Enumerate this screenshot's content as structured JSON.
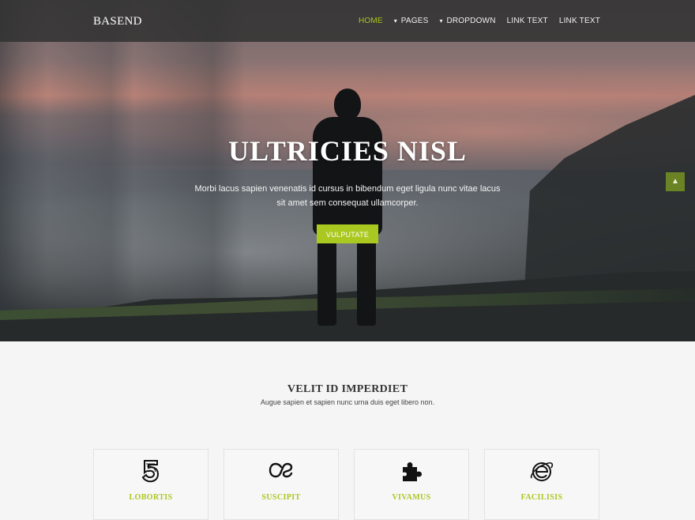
{
  "navbar": {
    "brand": "BASEND",
    "items": [
      {
        "label": "HOME",
        "active": true,
        "caret": ""
      },
      {
        "label": "PAGES",
        "active": false,
        "caret": "▾"
      },
      {
        "label": "DROPDOWN",
        "active": false,
        "caret": "▾"
      },
      {
        "label": "LINK TEXT",
        "active": false,
        "caret": ""
      },
      {
        "label": "LINK TEXT",
        "active": false,
        "caret": ""
      }
    ]
  },
  "hero": {
    "title": "ULTRICIES NISL",
    "text": "Morbi lacus sapien venenatis id cursus in bibendum eget ligula nunc vitae lacus sit amet sem consequat ullamcorper.",
    "button_label": "VULPUTATE"
  },
  "scroll_top": {
    "icon": "chevron-up-icon",
    "glyph": "▲"
  },
  "section": {
    "title": "VELIT ID IMPERDIET",
    "subtitle": "Augue sapien et sapien nunc urna duis eget libero non.",
    "cards": [
      {
        "label": "LOBORTIS",
        "icon": "five-icon"
      },
      {
        "label": "SUSCIPIT",
        "icon": "lastfm-icon"
      },
      {
        "label": "VIVAMUS",
        "icon": "puzzle-icon"
      },
      {
        "label": "FACILISIS",
        "icon": "internet-explorer-icon"
      }
    ]
  },
  "colors": {
    "accent": "#a9c820",
    "navbar_bg": "#323232",
    "section_bg": "#f5f5f5"
  }
}
